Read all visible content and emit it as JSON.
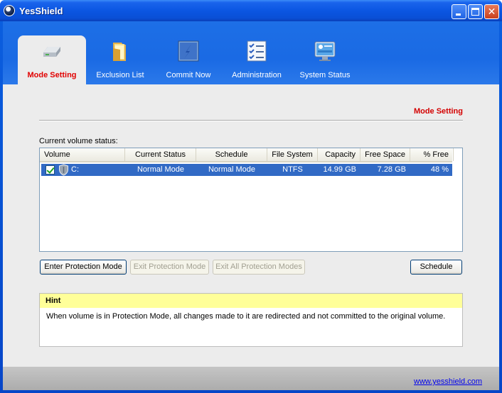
{
  "window": {
    "title": "YesShield"
  },
  "tabs": [
    {
      "label": "Mode Setting",
      "icon": "drive-icon",
      "active": true
    },
    {
      "label": "Exclusion List",
      "icon": "folder-icon",
      "active": false
    },
    {
      "label": "Commit Now",
      "icon": "commit-icon",
      "active": false
    },
    {
      "label": "Administration",
      "icon": "checklist-icon",
      "active": false
    },
    {
      "label": "System Status",
      "icon": "monitor-icon",
      "active": false
    }
  ],
  "main": {
    "section_title": "Mode Setting",
    "volume_label": "Current volume status:",
    "table": {
      "columns": [
        "Volume",
        "Current Status",
        "Schedule",
        "File System",
        "Capacity",
        "Free Space",
        "% Free"
      ],
      "rows": [
        {
          "volume": "C:",
          "current_status": "Normal Mode",
          "schedule": "Normal Mode",
          "file_system": "NTFS",
          "capacity": "14.99 GB",
          "free_space": "7.28 GB",
          "pct_free": "48 %",
          "checked": true,
          "selected": true
        }
      ]
    },
    "buttons": {
      "enter": "Enter Protection Mode",
      "exit": "Exit Protection Mode",
      "exit_all": "Exit All Protection Modes",
      "schedule": "Schedule"
    },
    "hint": {
      "title": "Hint",
      "text": "When volume is in Protection Mode, all changes made to it are redirected and not committed to the original volume."
    }
  },
  "footer": {
    "link": "www.yesshield.com"
  },
  "colors": {
    "title_bar": "#0b56e2",
    "active_tab_text": "#e10000",
    "selection": "#316ac5",
    "hint_header": "#ffff99",
    "link": "#0000ee"
  }
}
